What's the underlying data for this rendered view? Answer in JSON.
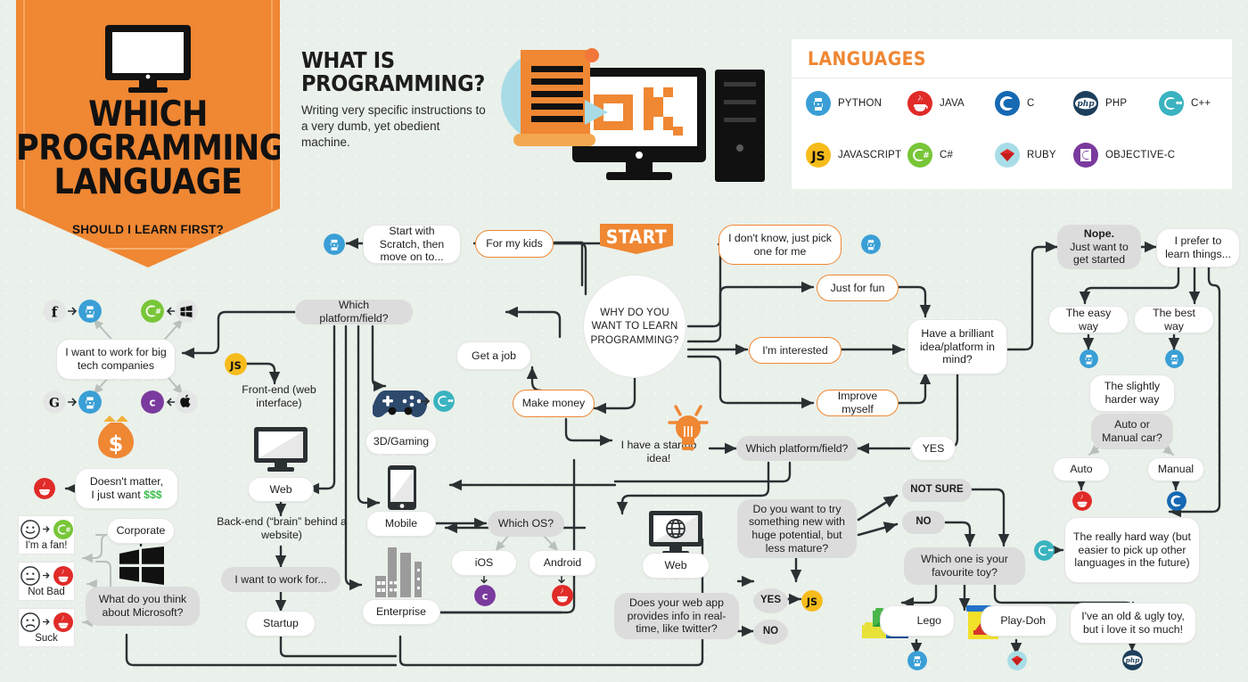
{
  "banner": {
    "icon": "desktop-monitor-icon",
    "line1": "WHICH",
    "line2": "PROGRAMMING",
    "line3": "LANGUAGE",
    "subtitle": "SHOULD I LEARN FIRST?",
    "bg_color": "#ef8733"
  },
  "whatis": {
    "title_line1": "WHAT IS",
    "title_line2": "PROGRAMMING?",
    "body": "Writing very specific instructions to a very dumb, yet obedient machine.",
    "hero_icon": "scroll-monitor-tower-ok-illustration",
    "hero_text": "OK"
  },
  "languages": {
    "title": "LANGUAGES",
    "items": [
      {
        "label": "PYTHON",
        "icon": "python-icon",
        "color": "#3a9fd6"
      },
      {
        "label": "JAVA",
        "icon": "java-icon",
        "color": "#e02b28"
      },
      {
        "label": "C",
        "icon": "c-icon",
        "color": "#1669b3"
      },
      {
        "label": "PHP",
        "icon": "php-icon",
        "color": "#1d3f5c"
      },
      {
        "label": "C++",
        "icon": "cpp-icon",
        "color": "#3bb3c0"
      },
      {
        "label": "JAVASCRIPT",
        "icon": "javascript-icon",
        "color": "#f6bc1c"
      },
      {
        "label": "C#",
        "icon": "csharp-icon",
        "color": "#78c638"
      },
      {
        "label": "RUBY",
        "icon": "ruby-icon",
        "color": "#a8dde7"
      },
      {
        "label": "OBJECTIVE-C",
        "icon": "objective-c-icon",
        "color": "#7a3a9e"
      }
    ]
  },
  "flow": {
    "start_label": "START",
    "root_question": "WHY DO YOU WANT TO LEARN PROGRAMMING?",
    "nodes": {
      "for_my_kids": "For my kids",
      "start_with_scratch": "Start with Scratch, then move on to...",
      "get_a_job": "Get a job",
      "make_money": "Make money",
      "i_have_startup_idea": "I have a startup idea!",
      "dont_know_pick": "I don't know, just pick one for me",
      "just_for_fun": "Just for fun",
      "im_interested": "I'm interested",
      "improve_myself": "Improve myself",
      "brilliant_idea": "Have a brilliant idea/platform in mind?",
      "yes_brilliant": "YES",
      "nope_get_started_bold": "Nope.",
      "nope_get_started_rest": "Just want to get started",
      "i_prefer_learn": "I prefer to learn things...",
      "easy_way": "The easy way",
      "best_way": "The best way",
      "slightly_harder": "The slightly harder way",
      "auto_or_manual": "Auto or Manual car?",
      "auto": "Auto",
      "manual": "Manual",
      "really_hard_way": "The really hard way (but easier to pick up other languages in the future)",
      "which_platform_left": "Which platform/field?",
      "which_platform_right": "Which platform/field?",
      "big_tech": "I want to work for big tech companies",
      "doesnt_matter_1": "Doesn't matter,",
      "doesnt_matter_2": "I just want",
      "doesnt_matter_money": "$$$",
      "front_end": "Front-end (web interface)",
      "back_end": "Back-end (“brain” behind a website)",
      "web_left": "Web",
      "i_want_work_for": "I want to work for...",
      "corporate": "Corporate",
      "startup": "Startup",
      "what_about_microsoft": "What do you think about Microsoft?",
      "gaming_3d": "3D/Gaming",
      "mobile": "Mobile",
      "enterprise": "Enterprise",
      "which_os": "Which OS?",
      "ios": "iOS",
      "android": "Android",
      "web_right": "Web",
      "realtime_q": "Does your web app provides info in real-time, like twitter?",
      "realtime_yes": "YES",
      "realtime_no": "NO",
      "try_something_new": "Do you want to try something new with huge potential, but less mature?",
      "not_sure": "NOT SURE",
      "no": "NO",
      "favourite_toy": "Which one is your favourite toy?",
      "lego": "Lego",
      "playdoh": "Play-Doh",
      "old_ugly_toy": "I've an old & ugly toy, but i love it so much!"
    },
    "faces": [
      {
        "caption": "I'm a fan!",
        "mouth": "smile",
        "result_icon": "csharp-icon"
      },
      {
        "caption": "Not Bad",
        "mouth": "neutral",
        "result_icon": "java-icon"
      },
      {
        "caption": "Suck",
        "mouth": "frown",
        "result_icon": "java-icon"
      }
    ],
    "company_icons": [
      {
        "name": "facebook-icon",
        "result": "python-icon"
      },
      {
        "name": "windows-icon",
        "result": "csharp-icon"
      },
      {
        "name": "google-icon",
        "result": "python-icon"
      },
      {
        "name": "apple-icon",
        "result": "objective-c-icon"
      }
    ],
    "illustrations": [
      "money-bag-icon",
      "gamepad-icon",
      "desktop-monitor-icon",
      "smartphone-icon",
      "buildings-icon",
      "globe-monitor-icon",
      "lightbulb-icon",
      "windows-logo-icon",
      "lego-bricks-icon",
      "playdoh-tub-icon"
    ]
  }
}
